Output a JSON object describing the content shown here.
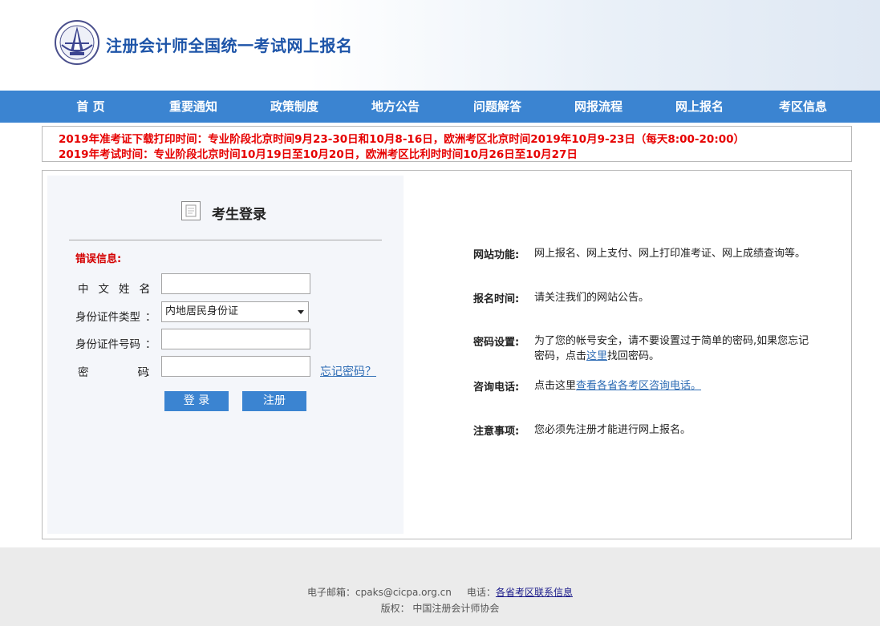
{
  "header": {
    "site_title": "注册会计师全国统一考试网上报名",
    "logo_icon": "cicpa-emblem-icon"
  },
  "nav": {
    "items": [
      {
        "label": "首 页"
      },
      {
        "label": "重要通知"
      },
      {
        "label": "政策制度"
      },
      {
        "label": "地方公告"
      },
      {
        "label": "问题解答"
      },
      {
        "label": "网报流程"
      },
      {
        "label": "网上报名"
      },
      {
        "label": "考区信息"
      }
    ]
  },
  "notice": {
    "line1": "2019年准考证下载打印时间：专业阶段北京时间9月23-30日和10月8-16日，欧洲考区北京时间2019年10月9-23日（每天8:00-20:00）",
    "line2": "2019年考试时间：专业阶段北京时间10月19日至10月20日，欧洲考区比利时时间10月26日至10月27日"
  },
  "login": {
    "title": "考生登录",
    "error_label": "错误信息:",
    "name_label_chars": [
      "中",
      "文",
      "姓",
      "名"
    ],
    "colon": "：",
    "id_type_label": "身份证件类型",
    "id_type_value": "内地居民身份证",
    "id_number_label": "身份证件号码",
    "password_label_chars": [
      "密",
      "码"
    ],
    "name_value": "",
    "id_number_value": "",
    "password_value": "",
    "forgot_link": "忘记密码？",
    "login_button": "登 录",
    "register_button": "注册"
  },
  "info": {
    "function_label": "网站功能:",
    "function_text": "网上报名、网上支付、网上打印准考证、网上成绩查询等。",
    "time_label": "报名时间:",
    "time_text": "请关注我们的网站公告。",
    "password_label": "密码设置:",
    "password_text_before": "为了您的帐号安全，请不要设置过于简单的密码,如果您忘记密码，点击",
    "password_link": "这里",
    "password_text_after": "找回密码。",
    "phone_label": "咨询电话:",
    "phone_text_before": "点击这里",
    "phone_link": "查看各省各考区咨询电话。",
    "note_label": "注意事项:",
    "note_text": "您必须先注册才能进行网上报名。"
  },
  "footer": {
    "email_label": "电子邮箱：",
    "email": "cpaks@cicpa.org.cn",
    "phone_label": "电话：",
    "phone_link": "各省考区联系信息",
    "copyright_label": "版权：",
    "copyright": "中国注册会计师协会"
  },
  "colors": {
    "nav_bg": "#3b84d1",
    "title_blue": "#1d54a8",
    "notice_red": "#e60000",
    "link_blue": "#2f6db5"
  }
}
